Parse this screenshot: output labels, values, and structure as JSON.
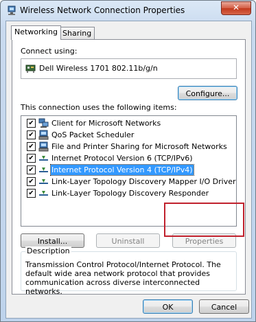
{
  "window": {
    "title": "Wireless Network Connection Properties",
    "close_label": "✕"
  },
  "tabs": [
    {
      "label": "Networking",
      "active": true
    },
    {
      "label": "Sharing",
      "active": false
    }
  ],
  "connect_using": {
    "label": "Connect using:",
    "adapter": "Dell Wireless 1701 802.11b/g/n",
    "configure_label": "Configure..."
  },
  "items_section": {
    "label": "This connection uses the following items:",
    "items": [
      {
        "label": "Client for Microsoft Networks",
        "checked": true,
        "icon": "network-client-icon"
      },
      {
        "label": "QoS Packet Scheduler",
        "checked": true,
        "icon": "network-service-icon"
      },
      {
        "label": "File and Printer Sharing for Microsoft Networks",
        "checked": true,
        "icon": "network-service-icon"
      },
      {
        "label": "Internet Protocol Version 6 (TCP/IPv6)",
        "checked": true,
        "icon": "protocol-icon"
      },
      {
        "label": "Internet Protocol Version 4 (TCP/IPv4)",
        "checked": true,
        "icon": "protocol-icon",
        "selected": true
      },
      {
        "label": "Link-Layer Topology Discovery Mapper I/O Driver",
        "checked": true,
        "icon": "protocol-icon"
      },
      {
        "label": "Link-Layer Topology Discovery Responder",
        "checked": true,
        "icon": "protocol-icon"
      }
    ]
  },
  "buttons": {
    "install": "Install...",
    "uninstall": "Uninstall",
    "properties": "Properties",
    "ok": "OK",
    "cancel": "Cancel"
  },
  "description": {
    "legend": "Description",
    "text": "Transmission Control Protocol/Internet Protocol. The default wide area network protocol that provides communication across diverse interconnected networks."
  },
  "colors": {
    "selection": "#3399ff",
    "highlight_box": "#c0202c"
  }
}
